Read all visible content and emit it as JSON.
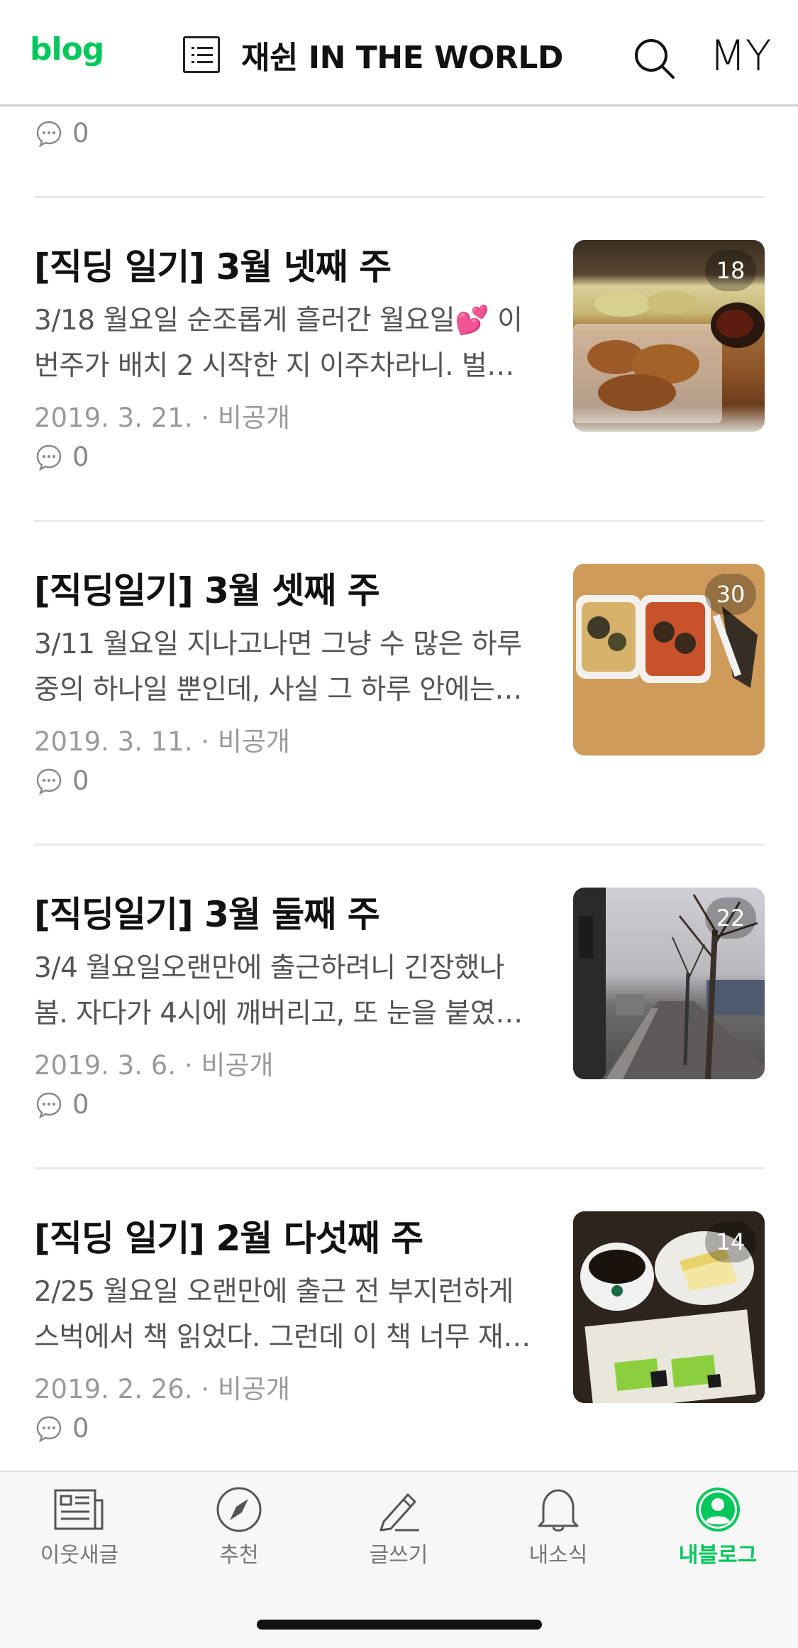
{
  "header": {
    "logo": "blog",
    "blog_title": "재쉰 IN THE WORLD",
    "my_label": "MY",
    "icons": [
      "list-icon",
      "search-icon"
    ]
  },
  "previous_post": {
    "comments": "0"
  },
  "posts": [
    {
      "title": "[직딩 일기] 3월 넷째 주",
      "excerpt_line1": "3/18 월요일 순조롭게 흘러간 월요일💕 이",
      "excerpt_line2": "번주가 배치 2 시작한 지 이주차라니. 벌…",
      "date": "2019. 3. 21.",
      "visibility": "비공개",
      "comments": "0",
      "photo_count": "18"
    },
    {
      "title": "[직딩일기] 3월 셋째 주",
      "excerpt_line1": "3/11 월요일 지나고나면 그냥 수 많은 하루",
      "excerpt_line2": "중의 하나일 뿐인데, 사실 그 하루 안에는…",
      "date": "2019. 3. 11.",
      "visibility": "비공개",
      "comments": "0",
      "photo_count": "30"
    },
    {
      "title": "[직딩일기] 3월 둘째 주",
      "excerpt_line1": "3/4 월요일오랜만에 출근하려니 긴장했나",
      "excerpt_line2": "봄. 자다가 4시에 깨버리고, 또 눈을 붙였…",
      "date": "2019. 3. 6.",
      "visibility": "비공개",
      "comments": "0",
      "photo_count": "22"
    },
    {
      "title": "[직딩 일기] 2월 다섯째 주",
      "excerpt_line1": "2/25 월요일 오랜만에 출근 전 부지런하게",
      "excerpt_line2": "스벅에서 책 읽었다. 그런데 이 책 너무 재…",
      "date": "2019. 2. 26.",
      "visibility": "비공개",
      "comments": "0",
      "photo_count": "14"
    }
  ],
  "bottom_nav": [
    {
      "label": "이웃새글",
      "icon": "newspaper-icon",
      "active": false
    },
    {
      "label": "추천",
      "icon": "compass-icon",
      "active": false
    },
    {
      "label": "글쓰기",
      "icon": "pencil-icon",
      "active": false
    },
    {
      "label": "내소식",
      "icon": "bell-icon",
      "active": false
    },
    {
      "label": "내블로그",
      "icon": "profile-icon",
      "active": true
    }
  ],
  "colors": {
    "brand_green": "#03c75a",
    "meta_gray": "#9a9a9a",
    "excerpt_gray": "#555555"
  }
}
